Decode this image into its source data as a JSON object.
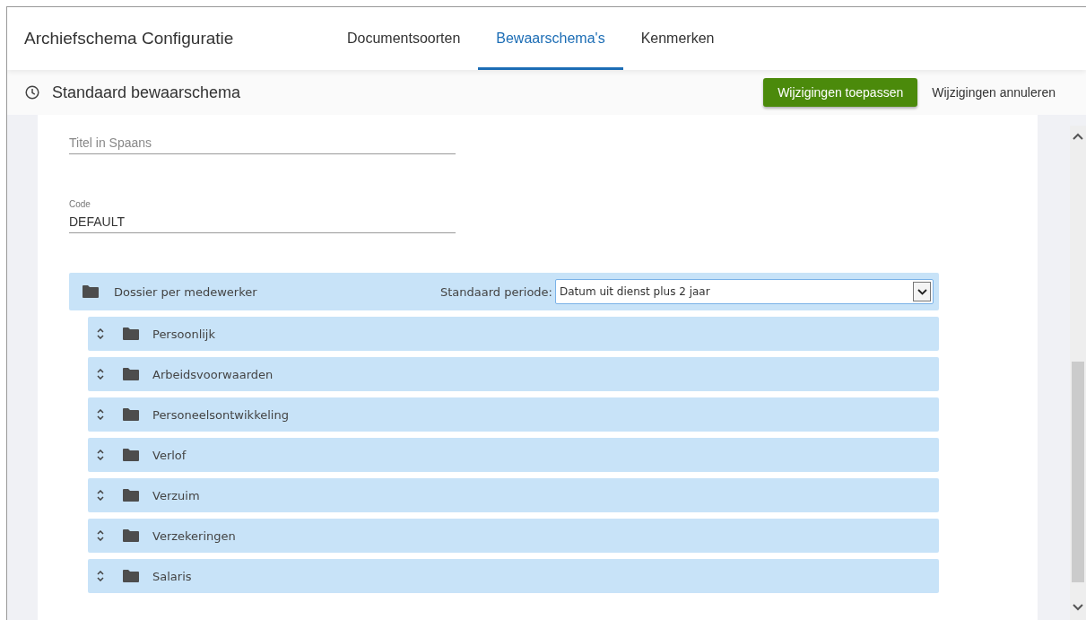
{
  "app_title": "Archiefschema Configuratie",
  "tabs": [
    {
      "label": "Documentsoorten",
      "selected": false
    },
    {
      "label": "Bewaarschema's",
      "selected": true
    },
    {
      "label": "Kenmerken",
      "selected": false
    }
  ],
  "subheader": {
    "title": "Standaard bewaarschema",
    "apply_button": "Wijzigingen toepassen",
    "cancel_button": "Wijzigingen annuleren"
  },
  "fields": [
    {
      "placeholder": "Titel in Spaans"
    },
    {
      "label": "Code",
      "value": "DEFAULT"
    }
  ],
  "root_folder": {
    "name": "Dossier per medewerker",
    "period_label": "Standaard periode:",
    "period_value": "Datum uit dienst plus 2 jaar"
  },
  "children": [
    {
      "name": "Persoonlijk"
    },
    {
      "name": "Arbeidsvoorwaarden"
    },
    {
      "name": "Personeelsontwikkeling"
    },
    {
      "name": "Verlof"
    },
    {
      "name": "Verzuim"
    },
    {
      "name": "Verzekeringen"
    },
    {
      "name": "Salaris"
    }
  ]
}
